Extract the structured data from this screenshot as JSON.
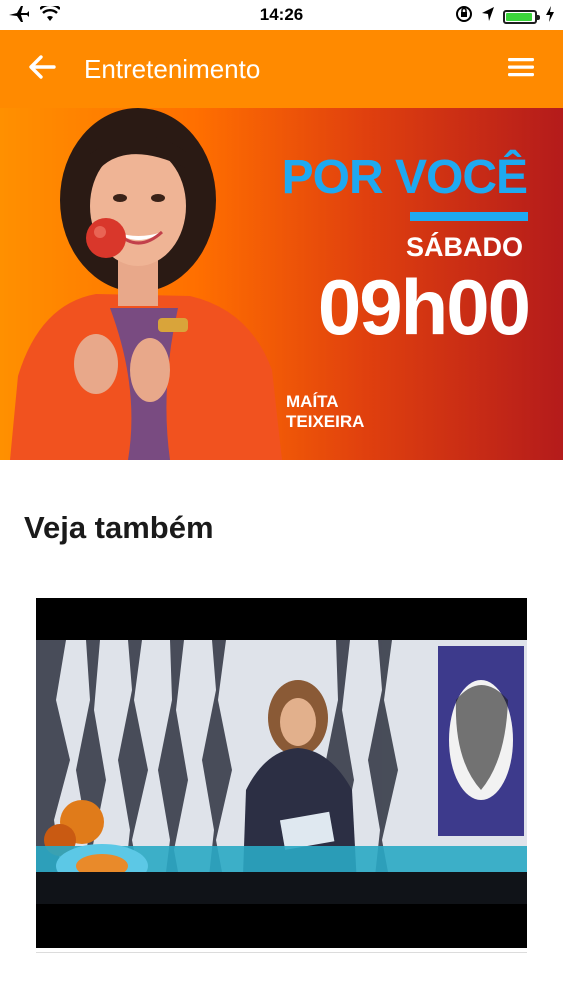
{
  "status_bar": {
    "time": "14:26",
    "icons": [
      "airplane-icon",
      "wifi-icon",
      "orientation-lock-icon",
      "location-arrow-icon",
      "battery-icon",
      "charging-icon"
    ]
  },
  "app_bar": {
    "title": "Entretenimento",
    "back_icon": "arrow-left-icon",
    "menu_icon": "hamburger-menu-icon",
    "color": "#ff8a00"
  },
  "banner": {
    "title": "POR VOCÊ",
    "day": "SÁBADO",
    "time": "09h00",
    "host_first": "MAÍTA",
    "host_last": "TEIXEIRA",
    "title_color": "#1fa9f0"
  },
  "section": {
    "title": "Veja também"
  }
}
